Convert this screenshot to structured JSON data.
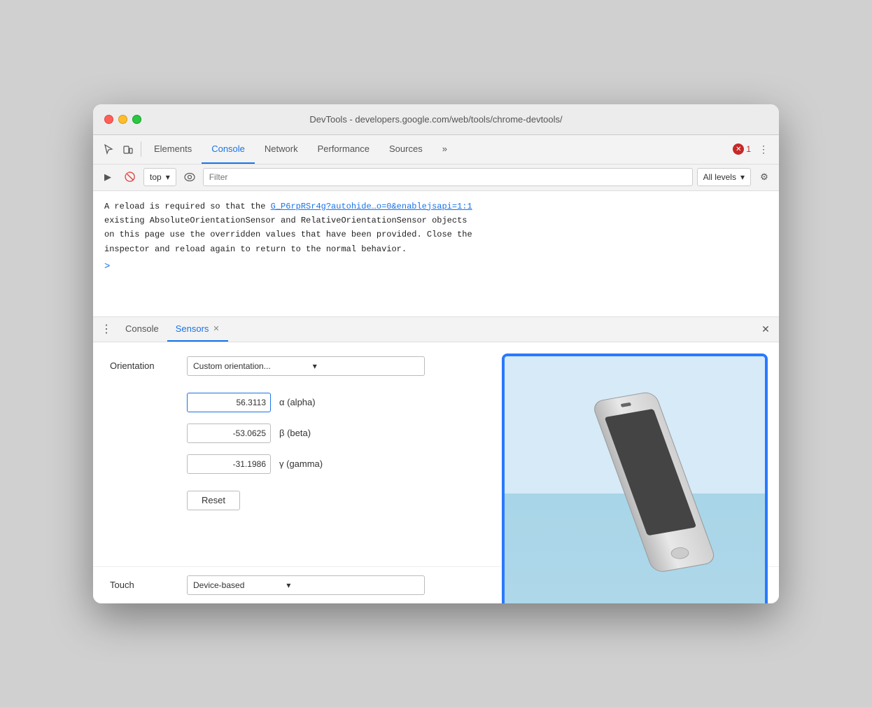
{
  "window": {
    "title": "DevTools - developers.google.com/web/tools/chrome-devtools/"
  },
  "tabs": {
    "elements": "Elements",
    "console": "Console",
    "network": "Network",
    "performance": "Performance",
    "sources": "Sources",
    "more": "»"
  },
  "toolbar2": {
    "context": "top",
    "filter_placeholder": "Filter",
    "levels": "All levels"
  },
  "errors": {
    "count": "1"
  },
  "console_message": {
    "line1": "A reload is required so that the ",
    "link": "G_P6rpRSr4g?autohide…o=0&enablejsapi=1:1",
    "line2": "existing AbsoluteOrientationSensor and RelativeOrientationSensor objects",
    "line3": "on this page use the overridden values that have been provided. Close the",
    "line4": "inspector and reload again to return to the normal behavior."
  },
  "bottom_tabs": {
    "console": "Console",
    "sensors": "Sensors"
  },
  "sensors": {
    "orientation_label": "Orientation",
    "orientation_value": "Custom orientation...",
    "alpha_value": "56.3113",
    "alpha_label": "α (alpha)",
    "beta_value": "-53.0625",
    "beta_label": "β (beta)",
    "gamma_value": "-31.1986",
    "gamma_label": "γ (gamma)",
    "reset_label": "Reset",
    "touch_label": "Touch",
    "touch_value": "Device-based"
  }
}
